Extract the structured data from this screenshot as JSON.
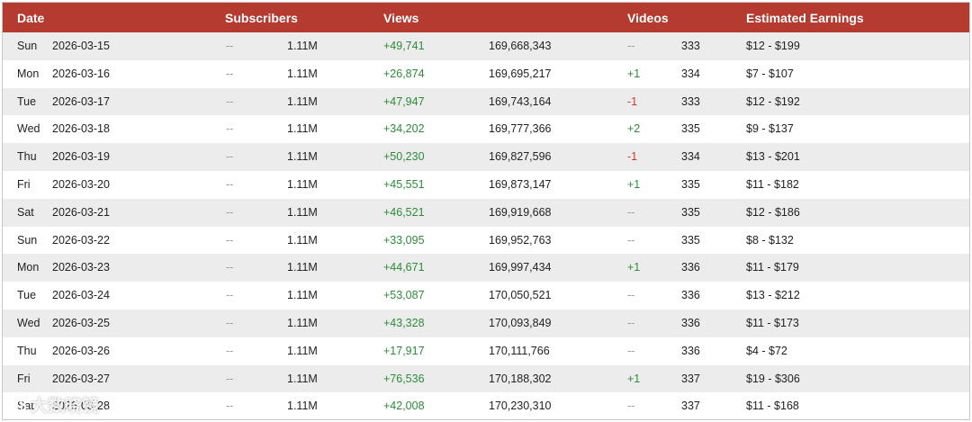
{
  "header": {
    "date": "Date",
    "subscribers": "Subscribers",
    "views": "Views",
    "videos": "Videos",
    "earnings": "Estimated Earnings"
  },
  "rows": [
    {
      "day": "Sun",
      "date": "2026-03-15",
      "sub_delta": "--",
      "sub_total": "1.11M",
      "views_delta": "+49,741",
      "views_total": "169,668,343",
      "videos_delta": "--",
      "videos_delta_type": "neu",
      "videos_total": "333",
      "earnings": "$12 - $199"
    },
    {
      "day": "Mon",
      "date": "2026-03-16",
      "sub_delta": "--",
      "sub_total": "1.11M",
      "views_delta": "+26,874",
      "views_total": "169,695,217",
      "videos_delta": "+1",
      "videos_delta_type": "pos",
      "videos_total": "334",
      "earnings": "$7 - $107"
    },
    {
      "day": "Tue",
      "date": "2026-03-17",
      "sub_delta": "--",
      "sub_total": "1.11M",
      "views_delta": "+47,947",
      "views_total": "169,743,164",
      "videos_delta": "-1",
      "videos_delta_type": "neg",
      "videos_total": "333",
      "earnings": "$12 - $192"
    },
    {
      "day": "Wed",
      "date": "2026-03-18",
      "sub_delta": "--",
      "sub_total": "1.11M",
      "views_delta": "+34,202",
      "views_total": "169,777,366",
      "videos_delta": "+2",
      "videos_delta_type": "pos",
      "videos_total": "335",
      "earnings": "$9 - $137"
    },
    {
      "day": "Thu",
      "date": "2026-03-19",
      "sub_delta": "--",
      "sub_total": "1.11M",
      "views_delta": "+50,230",
      "views_total": "169,827,596",
      "videos_delta": "-1",
      "videos_delta_type": "neg",
      "videos_total": "334",
      "earnings": "$13 - $201"
    },
    {
      "day": "Fri",
      "date": "2026-03-20",
      "sub_delta": "--",
      "sub_total": "1.11M",
      "views_delta": "+45,551",
      "views_total": "169,873,147",
      "videos_delta": "+1",
      "videos_delta_type": "pos",
      "videos_total": "335",
      "earnings": "$11 - $182"
    },
    {
      "day": "Sat",
      "date": "2026-03-21",
      "sub_delta": "--",
      "sub_total": "1.11M",
      "views_delta": "+46,521",
      "views_total": "169,919,668",
      "videos_delta": "--",
      "videos_delta_type": "neu",
      "videos_total": "335",
      "earnings": "$12 - $186"
    },
    {
      "day": "Sun",
      "date": "2026-03-22",
      "sub_delta": "--",
      "sub_total": "1.11M",
      "views_delta": "+33,095",
      "views_total": "169,952,763",
      "videos_delta": "--",
      "videos_delta_type": "neu",
      "videos_total": "335",
      "earnings": "$8 - $132"
    },
    {
      "day": "Mon",
      "date": "2026-03-23",
      "sub_delta": "--",
      "sub_total": "1.11M",
      "views_delta": "+44,671",
      "views_total": "169,997,434",
      "videos_delta": "+1",
      "videos_delta_type": "pos",
      "videos_total": "336",
      "earnings": "$11 - $179"
    },
    {
      "day": "Tue",
      "date": "2026-03-24",
      "sub_delta": "--",
      "sub_total": "1.11M",
      "views_delta": "+53,087",
      "views_total": "170,050,521",
      "videos_delta": "--",
      "videos_delta_type": "neu",
      "videos_total": "336",
      "earnings": "$13 - $212"
    },
    {
      "day": "Wed",
      "date": "2026-03-25",
      "sub_delta": "--",
      "sub_total": "1.11M",
      "views_delta": "+43,328",
      "views_total": "170,093,849",
      "videos_delta": "--",
      "videos_delta_type": "neu",
      "videos_total": "336",
      "earnings": "$11 - $173"
    },
    {
      "day": "Thu",
      "date": "2026-03-26",
      "sub_delta": "--",
      "sub_total": "1.11M",
      "views_delta": "+17,917",
      "views_total": "170,111,766",
      "videos_delta": "--",
      "videos_delta_type": "neu",
      "videos_total": "336",
      "earnings": "$4 - $72"
    },
    {
      "day": "Fri",
      "date": "2026-03-27",
      "sub_delta": "--",
      "sub_total": "1.11M",
      "views_delta": "+76,536",
      "views_total": "170,188,302",
      "videos_delta": "+1",
      "videos_delta_type": "pos",
      "videos_total": "337",
      "earnings": "$19 - $306"
    },
    {
      "day": "Sat",
      "date": "2026-03-28",
      "sub_delta": "--",
      "sub_total": "1.11M",
      "views_delta": "+42,008",
      "views_total": "170,230,310",
      "videos_delta": "--",
      "videos_delta_type": "neu",
      "videos_total": "337",
      "earnings": "$11 - $168"
    }
  ],
  "watermark": {
    "text": "大数晓镜"
  },
  "colors": {
    "header_bg": "#b53a2f",
    "positive": "#2e8b3a",
    "negative": "#d0392b",
    "neutral": "#9a9a9a",
    "row_alt": "#ececec"
  }
}
